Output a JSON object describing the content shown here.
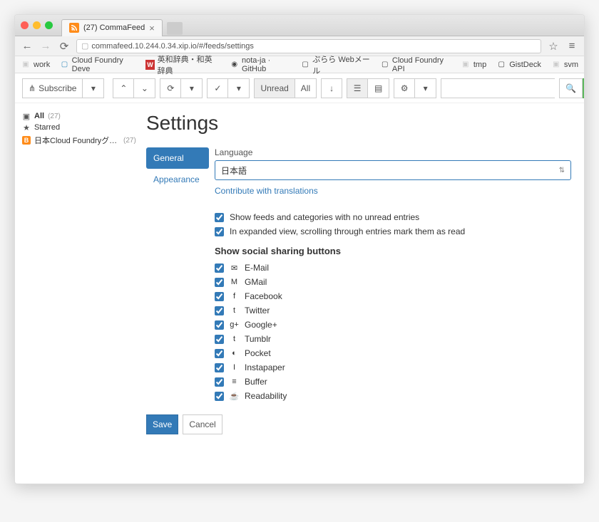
{
  "browser": {
    "tab_title": "(27) CommaFeed",
    "url": "commafeed.10.244.0.34.xip.io/#/feeds/settings",
    "bookmarks": [
      {
        "label": "work",
        "icon": "folder"
      },
      {
        "label": "Cloud Foundry Deve",
        "icon": "page"
      },
      {
        "label": "英和辞典・和英辞典",
        "icon": "w"
      },
      {
        "label": "nota-ja · GitHub",
        "icon": "github"
      },
      {
        "label": "ぷらら Webメール",
        "icon": "page"
      },
      {
        "label": "Cloud Foundry API",
        "icon": "page"
      },
      {
        "label": "tmp",
        "icon": "folder"
      },
      {
        "label": "GistDeck",
        "icon": "page"
      },
      {
        "label": "svm",
        "icon": "folder"
      }
    ]
  },
  "toolbar": {
    "subscribe": "Subscribe",
    "unread": "Unread",
    "all": "All"
  },
  "sidebar": {
    "all": {
      "label": "All",
      "count": "(27)"
    },
    "starred": {
      "label": "Starred"
    },
    "feeds": [
      {
        "label": "日本Cloud Foundryグループ ブログ",
        "count": "(27)"
      }
    ]
  },
  "page": {
    "title": "Settings",
    "tabs": {
      "general": "General",
      "appearance": "Appearance"
    },
    "language": {
      "label": "Language",
      "value": "日本語",
      "contribute": "Contribute with translations"
    },
    "checks": {
      "show_empty": "Show feeds and categories with no unread entries",
      "scroll_read": "In expanded view, scrolling through entries mark them as read"
    },
    "social": {
      "heading": "Show social sharing buttons",
      "items": [
        {
          "label": "E-Mail",
          "icon": "✉"
        },
        {
          "label": "GMail",
          "icon": "M"
        },
        {
          "label": "Facebook",
          "icon": "f"
        },
        {
          "label": "Twitter",
          "icon": "t"
        },
        {
          "label": "Google+",
          "icon": "g+"
        },
        {
          "label": "Tumblr",
          "icon": "t"
        },
        {
          "label": "Pocket",
          "icon": "◐"
        },
        {
          "label": "Instapaper",
          "icon": "I"
        },
        {
          "label": "Buffer",
          "icon": "≡"
        },
        {
          "label": "Readability",
          "icon": "☕"
        }
      ]
    },
    "actions": {
      "save": "Save",
      "cancel": "Cancel"
    }
  }
}
